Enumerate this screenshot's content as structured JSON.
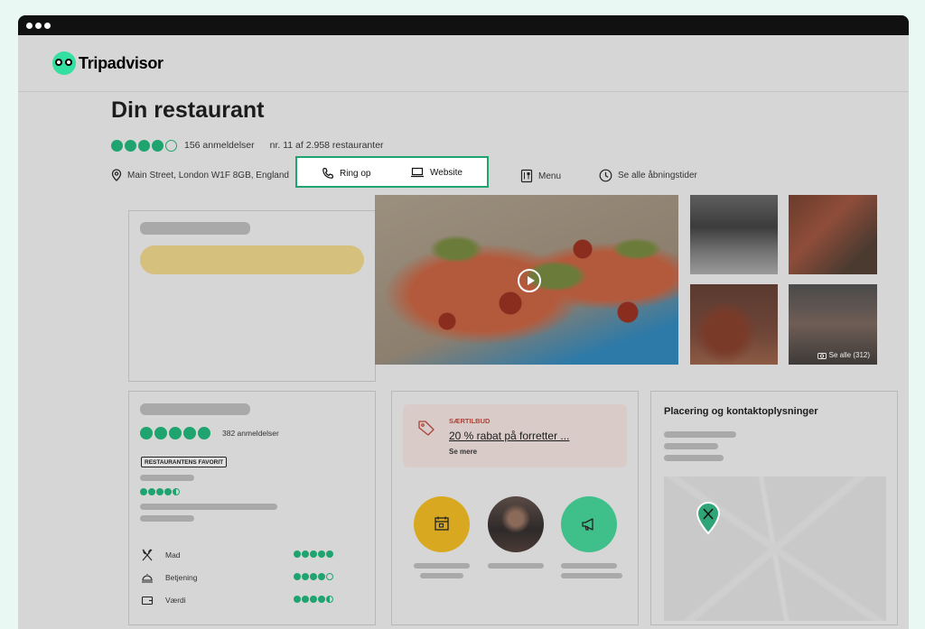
{
  "brand": {
    "name": "Tripadvisor"
  },
  "restaurant": {
    "title": "Din restaurant",
    "rating": 4,
    "rating_max": 5,
    "reviews": "156 anmeldelser",
    "rank": "nr. 11 af 2.958 restauranter",
    "address": "Main Street, London W1F 8GB, England",
    "call_label": "Ring op",
    "website_label": "Website",
    "menu_label": "Menu",
    "hours_label": "Se alle åbningstider"
  },
  "photos": {
    "see_all": "Se alle (312)"
  },
  "summary_card": {
    "rating": 5,
    "reviews": "382 anmeldelser",
    "badge": "RESTAURANTENS FAVORIT",
    "sub_rating": 4.5,
    "categories": [
      {
        "label": "Mad",
        "rating": 5,
        "icon": "fork-knife-icon"
      },
      {
        "label": "Betjening",
        "rating": 4,
        "icon": "cloche-icon"
      },
      {
        "label": "Værdi",
        "rating": 4.5,
        "icon": "wallet-icon"
      }
    ]
  },
  "offer": {
    "label": "SÆRTILBUD",
    "text": "20 % rabat på forretter ...",
    "more": "Se mere"
  },
  "features": [
    {
      "icon": "calendar-icon",
      "color": "#d8a920"
    },
    {
      "icon": "musician-photo",
      "color": "#3a3a3a"
    },
    {
      "icon": "megaphone-icon",
      "color": "#3fc08a"
    }
  ],
  "contact": {
    "title": "Placering og kontaktoplysninger"
  },
  "colors": {
    "accent": "#1fa36f",
    "mint": "#34e0a1",
    "offer_bg": "#d9ccc8",
    "offer_red": "#a8433a",
    "highlight_bar": "#d6c07e"
  }
}
